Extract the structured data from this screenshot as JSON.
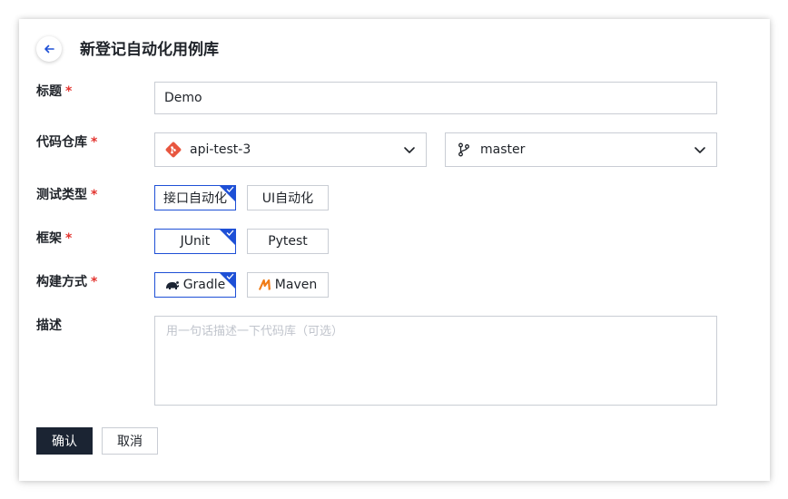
{
  "header": {
    "title": "新登记自动化用例库",
    "back_icon": "arrow-left-icon"
  },
  "form": {
    "title_field": {
      "label": "标题",
      "value": "Demo",
      "required_mark": "*"
    },
    "repo_field": {
      "label": "代码仓库",
      "required_mark": "*",
      "repo": {
        "value": "api-test-3",
        "icon": "git-icon"
      },
      "branch": {
        "value": "master",
        "icon": "branch-icon"
      }
    },
    "test_type_field": {
      "label": "测试类型",
      "required_mark": "*",
      "options": [
        {
          "label": "接口自动化",
          "selected": true
        },
        {
          "label": "UI自动化",
          "selected": false
        }
      ]
    },
    "framework_field": {
      "label": "框架",
      "required_mark": "*",
      "options": [
        {
          "label": "JUnit",
          "selected": true
        },
        {
          "label": "Pytest",
          "selected": false
        }
      ]
    },
    "build_field": {
      "label": "构建方式",
      "required_mark": "*",
      "options": [
        {
          "label": "Gradle",
          "selected": true,
          "icon": "gradle-icon"
        },
        {
          "label": "Maven",
          "selected": false,
          "icon": "maven-icon"
        }
      ]
    },
    "description_field": {
      "label": "描述",
      "placeholder": "用一句话描述一下代码库（可选）"
    }
  },
  "actions": {
    "confirm_label": "确认",
    "cancel_label": "取消"
  },
  "colors": {
    "accent": "#1e50d6",
    "primary_button": "#1b2433",
    "required": "#e3342f",
    "git": "#e8563f",
    "maven": "#f07b16"
  }
}
